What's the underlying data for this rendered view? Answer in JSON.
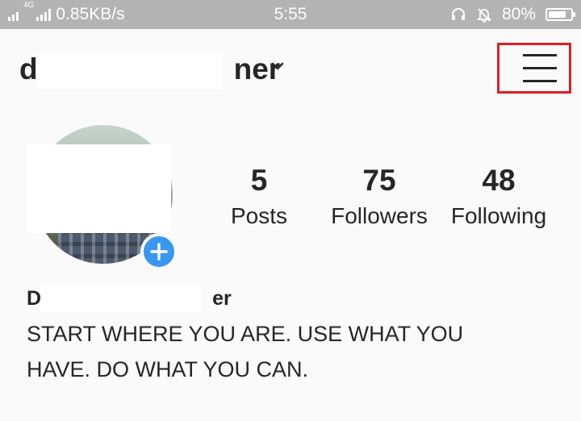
{
  "status_bar": {
    "network_badge": "4G",
    "speed": "0.85KB/s",
    "time": "5:55",
    "battery_text": "80%",
    "battery_level": 0.8,
    "icons": [
      "signal-icon",
      "headset-icon",
      "bell-muted-icon",
      "battery-icon"
    ]
  },
  "header": {
    "username_start": "d",
    "username_end": "ner",
    "dropdown_icon": "chevron-down-icon",
    "menu_icon": "hamburger-menu-icon",
    "highlight_color": "#e01e24"
  },
  "profile": {
    "avatar_add_icon": "plus-icon",
    "accent_color": "#3897f0",
    "stats": {
      "posts": {
        "value": "5",
        "label": "Posts"
      },
      "followers": {
        "value": "75",
        "label": "Followers"
      },
      "following": {
        "value": "48",
        "label": "Following"
      }
    },
    "display_name_start": "D",
    "display_name_end": "er",
    "bio_line1": "START WHERE YOU ARE. USE WHAT YOU",
    "bio_line2": "HAVE. DO WHAT YOU CAN."
  }
}
